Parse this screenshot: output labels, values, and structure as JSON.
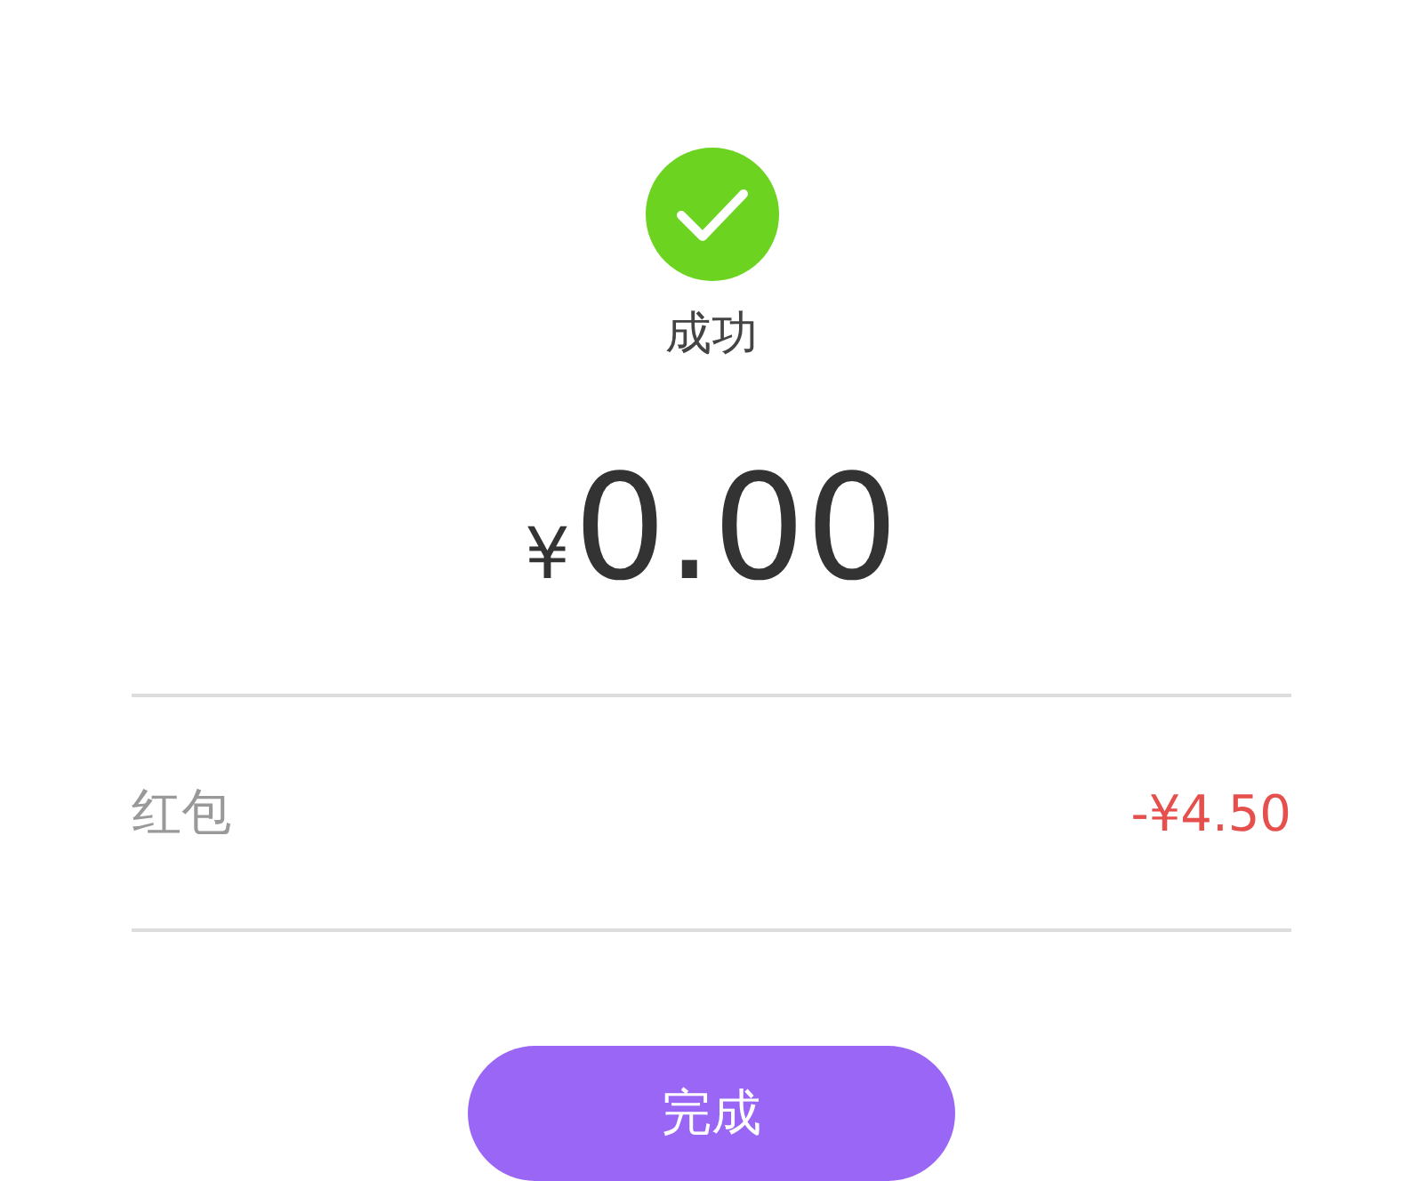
{
  "status": {
    "label": "成功",
    "success": true
  },
  "amount": {
    "currency": "¥",
    "value": "0.00"
  },
  "details": [
    {
      "label": "红包",
      "value": "-¥4.50"
    }
  ],
  "done_button": {
    "label": "完成"
  }
}
